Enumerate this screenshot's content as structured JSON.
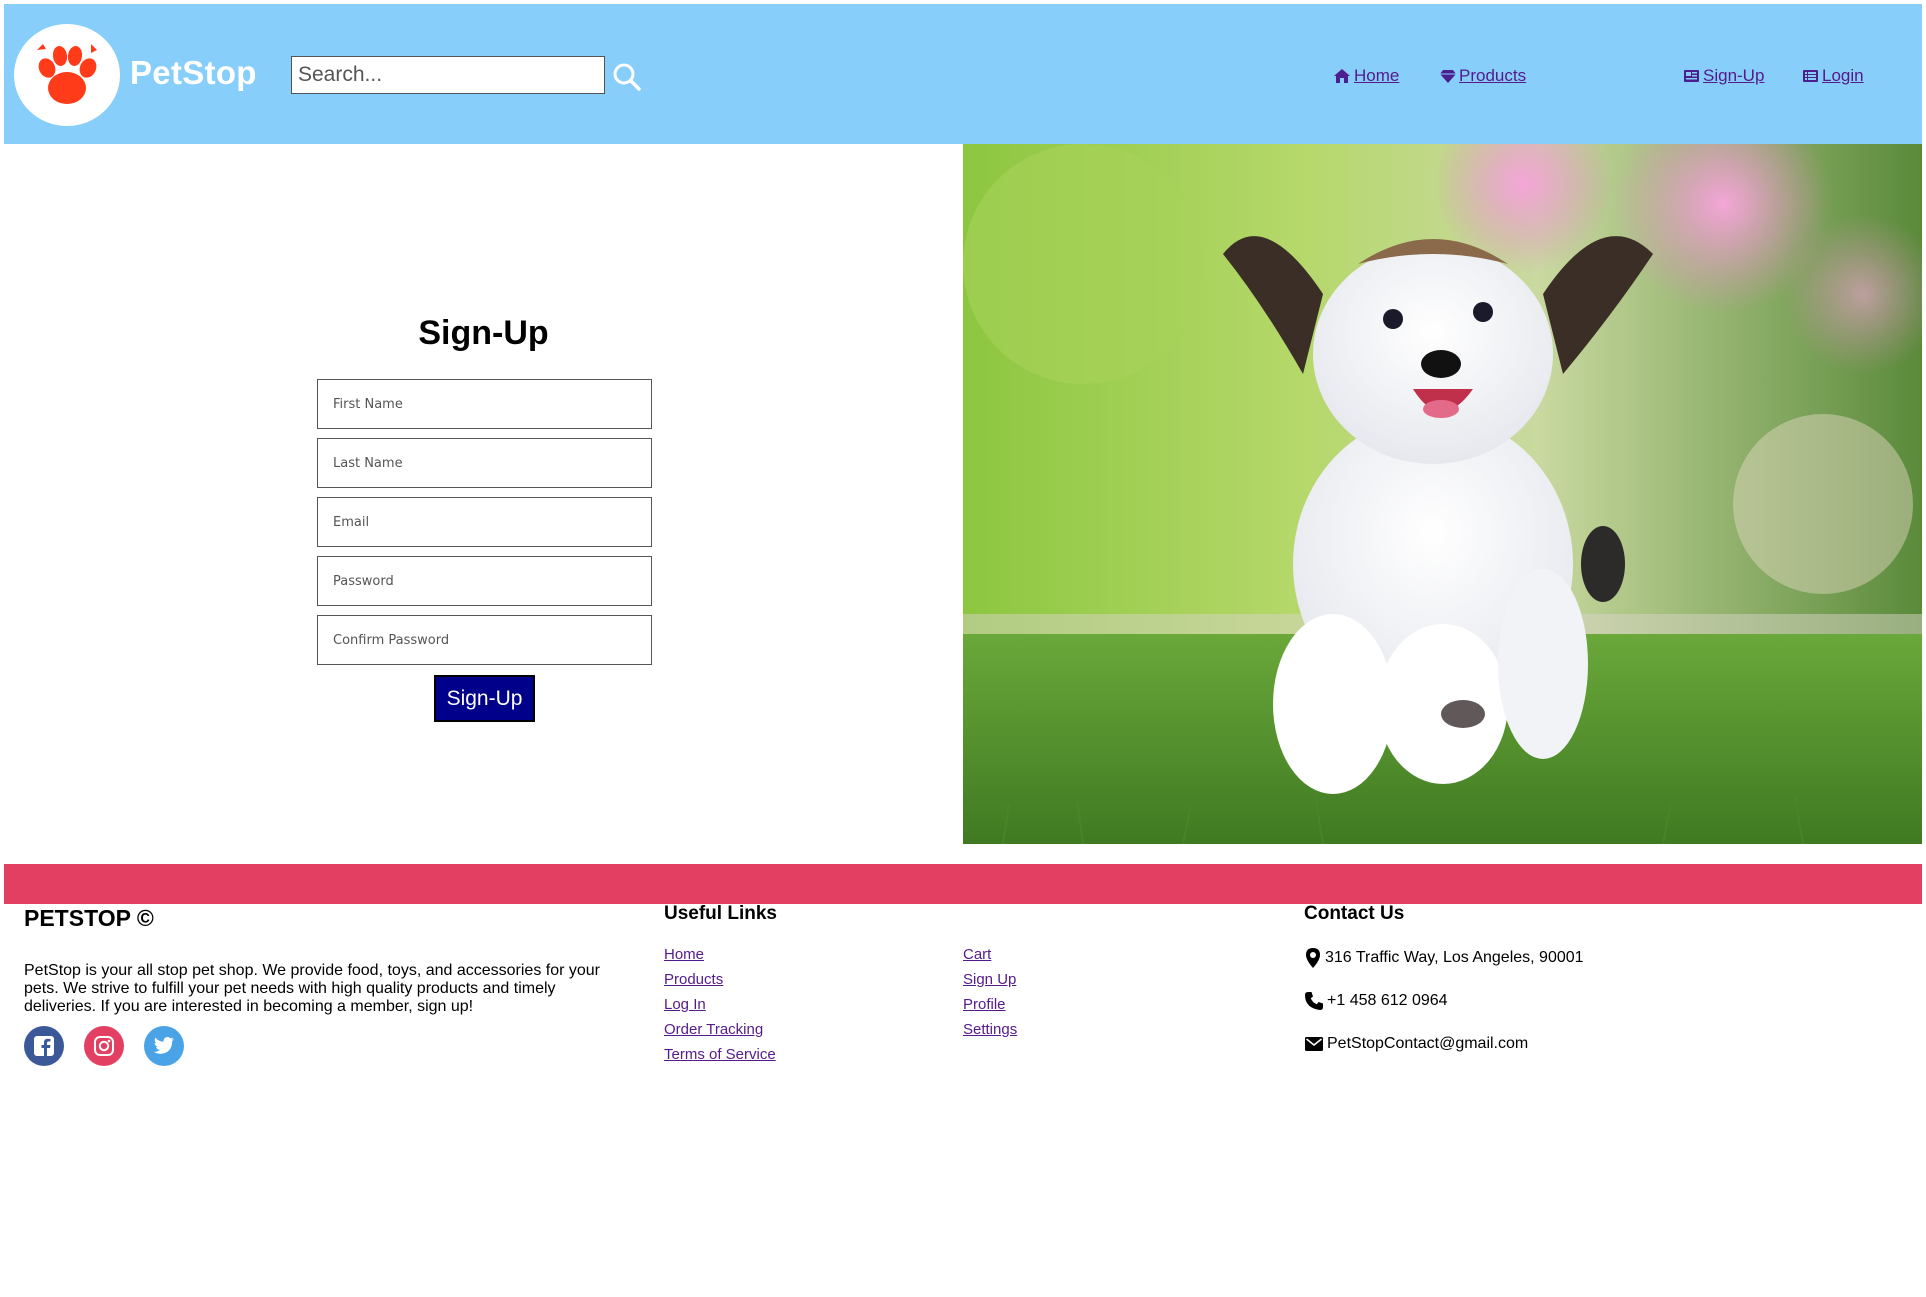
{
  "header": {
    "brand": "PetStop",
    "search_placeholder": "Search...",
    "nav": {
      "home": "Home",
      "products": "Products",
      "signup": "Sign-Up",
      "login": "Login"
    },
    "colors": {
      "background": "#87cefa",
      "logo": "#ff3b1a"
    }
  },
  "signup_form": {
    "title": "Sign-Up",
    "fields": {
      "first_name": "First Name",
      "last_name": "Last Name",
      "email": "Email",
      "password": "Password",
      "confirm_password": "Confirm Password"
    },
    "submit_label": "Sign-Up",
    "submit_color": "#00008b"
  },
  "hero_image": {
    "subject": "puppy-running-on-grass"
  },
  "footer": {
    "bar_color": "#e23f62",
    "brand": "PETSTOP ©",
    "description": "PetStop is your all stop pet shop. We provide food, toys, and accessories for your pets. We strive to fulfill your pet needs with high quality products and timely deliveries. If you are interested in becoming a member, sign up!",
    "social": [
      "facebook-icon",
      "instagram-icon",
      "twitter-icon"
    ],
    "useful_links": {
      "title": "Useful Links",
      "col1": [
        "Home",
        "Products",
        "Log In",
        "Order Tracking",
        "Terms of Service"
      ],
      "col2": [
        "Cart",
        "Sign Up",
        "Profile",
        "Settings"
      ]
    },
    "contact": {
      "title": "Contact Us",
      "address": "316 Traffic Way, Los Angeles, 90001",
      "phone": "+1 458 612 0964",
      "email": "PetStopContact@gmail.com"
    }
  }
}
